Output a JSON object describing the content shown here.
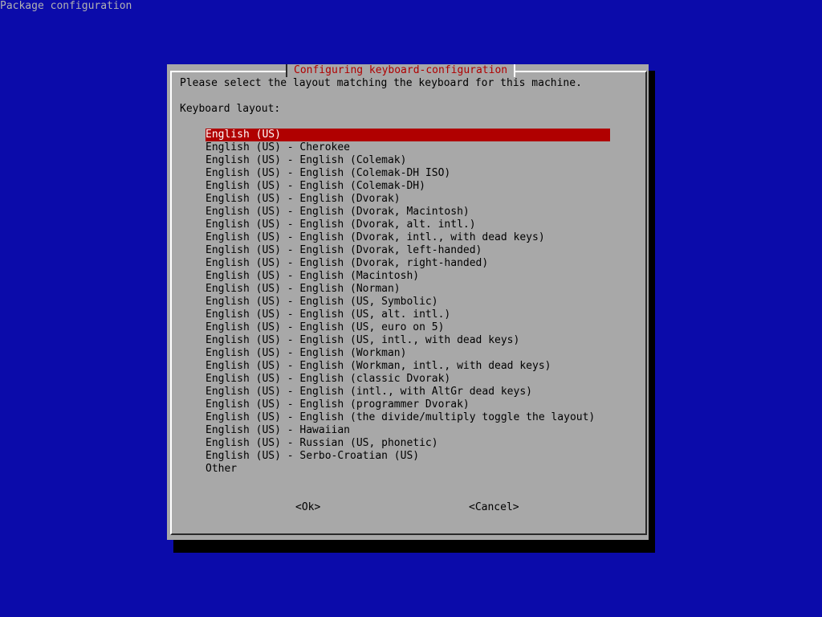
{
  "backtitle": "Package configuration",
  "dialog": {
    "title": "Configuring keyboard-configuration",
    "prompt": "Please select the layout matching the keyboard for this machine.",
    "label": "Keyboard layout:",
    "selected_index": 0,
    "items": [
      "English (US)",
      "English (US) - Cherokee",
      "English (US) - English (Colemak)",
      "English (US) - English (Colemak-DH ISO)",
      "English (US) - English (Colemak-DH)",
      "English (US) - English (Dvorak)",
      "English (US) - English (Dvorak, Macintosh)",
      "English (US) - English (Dvorak, alt. intl.)",
      "English (US) - English (Dvorak, intl., with dead keys)",
      "English (US) - English (Dvorak, left-handed)",
      "English (US) - English (Dvorak, right-handed)",
      "English (US) - English (Macintosh)",
      "English (US) - English (Norman)",
      "English (US) - English (US, Symbolic)",
      "English (US) - English (US, alt. intl.)",
      "English (US) - English (US, euro on 5)",
      "English (US) - English (US, intl., with dead keys)",
      "English (US) - English (Workman)",
      "English (US) - English (Workman, intl., with dead keys)",
      "English (US) - English (classic Dvorak)",
      "English (US) - English (intl., with AltGr dead keys)",
      "English (US) - English (programmer Dvorak)",
      "English (US) - English (the divide/multiply toggle the layout)",
      "English (US) - Hawaiian",
      "English (US) - Russian (US, phonetic)",
      "English (US) - Serbo-Croatian (US)",
      "Other"
    ],
    "ok_label": "<Ok>",
    "cancel_label": "<Cancel>"
  },
  "colors": {
    "background": "#0b0baa",
    "dialog": "#a8a8a8",
    "highlight": "#b00000",
    "title_text": "#b00000"
  }
}
